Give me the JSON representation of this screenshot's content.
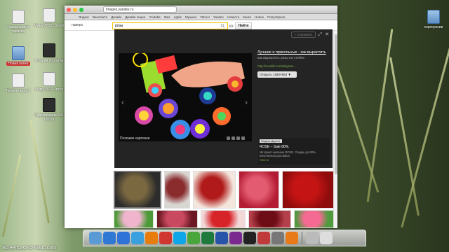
{
  "desktop": {
    "icons_left": [
      {
        "label": "Газонгранину тарахан",
        "icon": "document-icon"
      },
      {
        "label": "Новая папка",
        "icon": "folder-icon"
      },
      {
        "label": "Презентация 1",
        "icon": "presentation-icon"
      }
    ],
    "icons_middle": [
      {
        "label": "Маму 2012...ps.ktx",
        "icon": "image-file-icon"
      },
      {
        "label": "история портатив",
        "icon": "photo-file-icon"
      },
      {
        "label": "Маму 2012...ps.tx",
        "icon": "document-icon"
      },
      {
        "label": "Подключение-101 (2020)",
        "icon": "music-file-icon"
      }
    ],
    "icons_right": [
      {
        "label": "корпоратив",
        "icon": "folder-icon"
      }
    ]
  },
  "browser": {
    "url": "images.yandex.ru",
    "bookmarks": [
      "Яндекс",
      "Вконтакте",
      "Дизайн",
      "Дизайн лицее",
      "Youtube",
      "Жиз",
      "Apple",
      "Музыка",
      "Yahoo!",
      "Yandex",
      "Новости",
      "Книги",
      "Новое",
      "Популярное"
    ],
    "region": "наверх",
    "search_query": "розы",
    "search_button": "Найти"
  },
  "viewer": {
    "collection_button": "+ Сохранить",
    "similar_label": "Похожие картинки",
    "title": "Лучшие и прикольные - как вырастить",
    "description": "как вырастить розы на стебле",
    "source_url": "http://roselife.ru/radug/ras...",
    "open_button": "Открыть 1280×853 ▼"
  },
  "ad": {
    "badge": "Яндекс.Директ",
    "title": "ROSE – Sale 80%.",
    "text": "Интернет-магазин ROSE. Скидки до 80%. Бесплатная доставка!",
    "link": "rose.ru"
  },
  "thumbnails": {
    "row1": [
      {
        "colors": [
          "#7a6840",
          "#2c2c2c"
        ],
        "selected": true
      },
      {
        "colors": [
          "#8a2b2e",
          "#d9d7d2"
        ]
      },
      {
        "colors": [
          "#b01a1a",
          "#f3e6dc"
        ]
      },
      {
        "colors": [
          "#e35b70",
          "#b31c33"
        ]
      },
      {
        "colors": [
          "#c41414",
          "#8f0c0c"
        ]
      }
    ],
    "row2": [
      {
        "colors": [
          "#f0b4cd",
          "#4c9a37"
        ]
      },
      {
        "colors": [
          "#c94a60",
          "#6c1824"
        ]
      },
      {
        "colors": [
          "#d72429",
          "#f3d8d9"
        ]
      },
      {
        "colors": [
          "#6f0d17",
          "#b3404b"
        ]
      },
      {
        "colors": [
          "#f56a92",
          "#4f9a3d"
        ]
      }
    ]
  },
  "dock": {
    "apps": [
      {
        "icon": "finder-icon",
        "color": "#5b9bd5"
      },
      {
        "icon": "chrome-icon",
        "color": "#2f79d5"
      },
      {
        "icon": "appstore-icon",
        "color": "#2f72d8"
      },
      {
        "icon": "safari-icon",
        "color": "#3aa0de"
      },
      {
        "icon": "vlc-icon",
        "color": "#e87d0d"
      },
      {
        "icon": "yandex-browser-icon",
        "color": "#d0362f"
      },
      {
        "icon": "skype-icon",
        "color": "#0ea6e8"
      },
      {
        "icon": "utorrent-icon",
        "color": "#49a63b"
      },
      {
        "icon": "excel-icon",
        "color": "#1f7a3d"
      },
      {
        "icon": "word-icon",
        "color": "#2754a8"
      },
      {
        "icon": "close-app-icon",
        "color": "#7a2a8f"
      },
      {
        "icon": "terminal-icon",
        "color": "#222"
      },
      {
        "icon": "photo-app-icon",
        "color": "#c03a3a"
      },
      {
        "icon": "dvd-icon",
        "color": "#777"
      },
      {
        "icon": "pages-icon",
        "color": "#e97a1a"
      }
    ],
    "right_items": [
      {
        "icon": "downloads-stack-icon",
        "color": "#bbb"
      },
      {
        "icon": "trash-icon",
        "color": "#ddd"
      }
    ]
  },
  "watermark": "Screencast-O-Matic.com"
}
